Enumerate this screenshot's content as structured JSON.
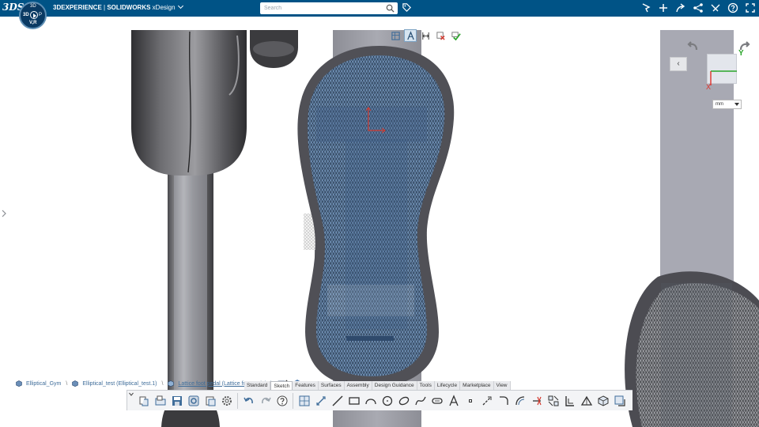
{
  "topbar": {
    "brand_logo": "3DS",
    "compass": {
      "top": "3D",
      "left": "3D",
      "right": "P",
      "bottom": "V,R"
    },
    "app_name_bold": "3DEXPERIENCE",
    "app_name_sep": " | ",
    "product": "SOLIDWORKS",
    "role": " xDesign",
    "search_placeholder": "Search",
    "right_icons": [
      "share-dashboard-icon",
      "add-icon",
      "share-icon",
      "network-icon",
      "community-icon",
      "help-icon",
      "fullscreen-icon"
    ]
  },
  "heads_up": {
    "tools": [
      "view-orientation-icon",
      "sketch-orientation-icon",
      "dimension-icon",
      "exit-sketch-icon",
      "accept-sketch-icon"
    ]
  },
  "view_cube": {
    "units": "mm",
    "axis_y": "Y",
    "axis_x": "X",
    "back_label": "‹"
  },
  "breadcrumb": {
    "items": [
      {
        "label": "Elliptical_Gym"
      },
      {
        "label": "Elliptical_test (Elliptical_test.1)"
      },
      {
        "label": "Lattice foot pedal (Lattice foot pedal.1)"
      }
    ],
    "separator": "\\"
  },
  "command_manager": {
    "tabs": [
      "Standard",
      "Sketch",
      "Features",
      "Surfaces",
      "Assembly",
      "Design Guidance",
      "Tools",
      "Lifecycle",
      "Marketplace",
      "View"
    ],
    "active_tab": "Sketch",
    "tools": [
      "new-icon",
      "open-icon",
      "save-icon",
      "save-as-icon",
      "revision-icon",
      "settings-icon",
      "undo-icon",
      "redo-icon",
      "help-icon",
      "sketch-icon",
      "smart-dimension-icon",
      "line-icon",
      "rectangle-icon",
      "arc-icon",
      "circle-icon",
      "ellipse-icon",
      "spline-icon",
      "slot-icon",
      "text-icon",
      "point-icon",
      "centerline-icon",
      "fillet-icon",
      "offset-icon",
      "trim-icon",
      "convert-icon",
      "mirror-icon",
      "pattern-icon",
      "3d-sketch-icon",
      "block-icon"
    ]
  },
  "colors": {
    "topbar": "#005386",
    "model_dark": "#3a3a3d",
    "lattice_fill": "#5d7fa3",
    "accent": "#3f6d9a",
    "axis_y": "#2aa52a",
    "axis_x": "#e0302a"
  }
}
